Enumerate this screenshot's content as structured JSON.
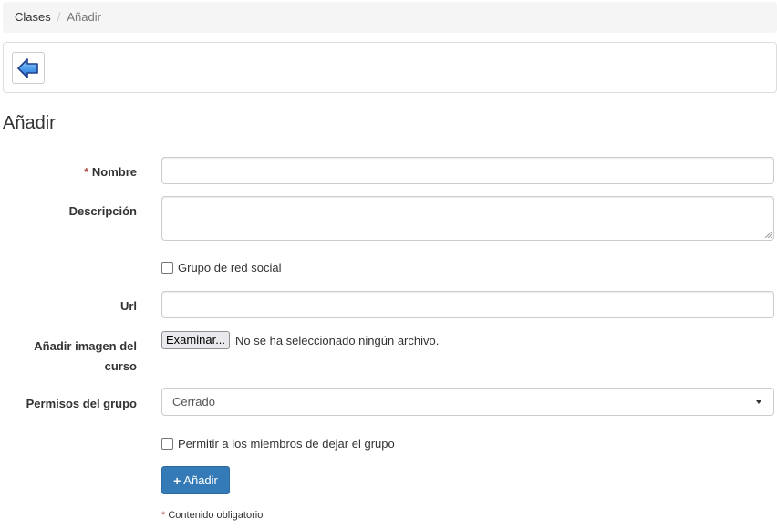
{
  "breadcrumb": {
    "items": [
      "Clases",
      "Añadir"
    ],
    "separator": "/"
  },
  "toolbar": {
    "back_icon": "arrow-left-icon"
  },
  "page": {
    "title": "Añadir"
  },
  "form": {
    "required_mark": "*",
    "nombre": {
      "label": "Nombre",
      "value": ""
    },
    "descripcion": {
      "label": "Descripción",
      "value": ""
    },
    "social_group": {
      "label": "Grupo de red social",
      "checked": false
    },
    "url": {
      "label": "Url",
      "value": ""
    },
    "image": {
      "label_line1": "Añadir imagen del",
      "label_line2": "curso",
      "button": "Examinar...",
      "status": "No se ha seleccionado ningún archivo."
    },
    "permissions": {
      "label": "Permisos del grupo",
      "selected": "Cerrado"
    },
    "allow_leave": {
      "label": "Permitir a los miembros de dejar el grupo",
      "checked": false
    },
    "submit": {
      "icon": "plus-icon",
      "label": "Añadir"
    },
    "footnote": "Contenido obligatorio"
  },
  "colors": {
    "primary": "#337ab7",
    "required": "#a94442",
    "back_arrow": "#2a6fd6"
  }
}
